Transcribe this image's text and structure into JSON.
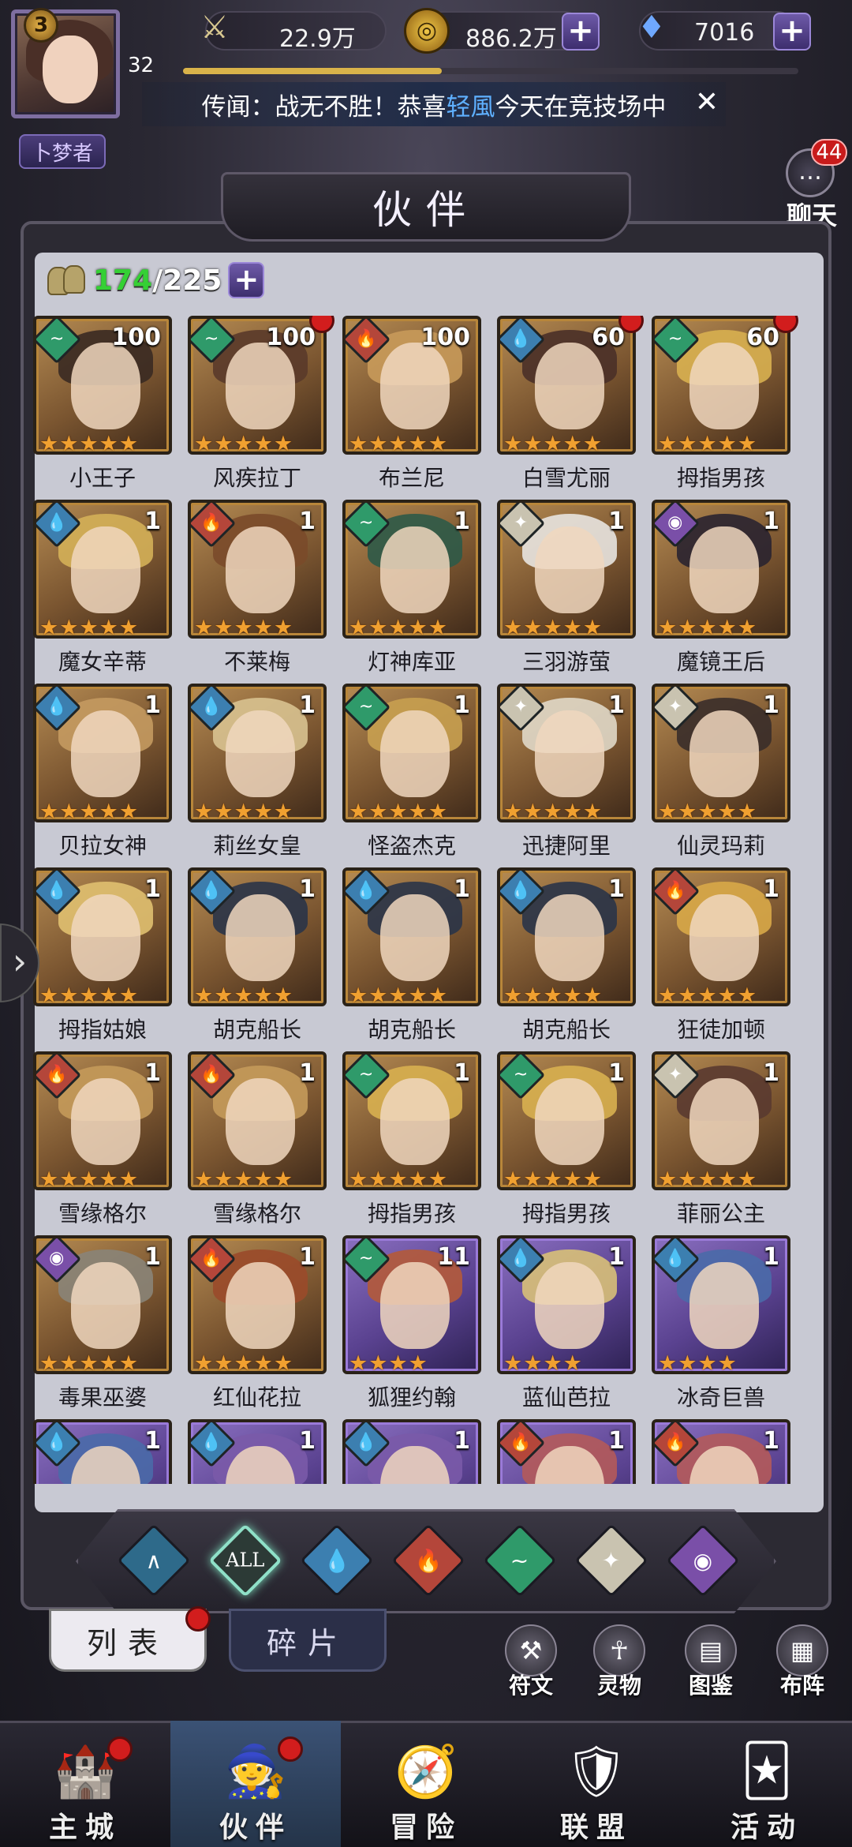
{
  "header": {
    "player_level": "3",
    "player_sub_level": "32",
    "player_title": "卜梦者",
    "power": "22.9万",
    "gold": "886.2万",
    "gems": "7016",
    "xp_progress": 0.42,
    "rumor_prefix": "传闻：战无不胜！恭喜",
    "rumor_name": "轻風",
    "rumor_suffix": "今天在竞技场中",
    "chat_label": "聊天",
    "chat_unread": "44"
  },
  "title": "伙伴",
  "roster": {
    "current": "174",
    "max": "/225"
  },
  "colors": {
    "water": "#3c7fb0",
    "wind": "#2f9a6a",
    "fire": "#b4463a",
    "light": "#c9c3b0",
    "dark": "#7a4fa8"
  },
  "heroes": [
    {
      "name": "小王子",
      "level": "100",
      "element": "wind",
      "frame": "gold",
      "stars": 5,
      "red": false,
      "hair": "#3a2a22"
    },
    {
      "name": "风疾拉丁",
      "level": "100",
      "element": "wind",
      "frame": "gold",
      "stars": 5,
      "red": true,
      "hair": "#5a3a2a"
    },
    {
      "name": "布兰尼",
      "level": "100",
      "element": "fire",
      "frame": "gold",
      "stars": 5,
      "red": false,
      "hair": "#c89a5a"
    },
    {
      "name": "白雪尤丽",
      "level": "60",
      "element": "water",
      "frame": "gold",
      "stars": 5,
      "red": true,
      "hair": "#4a3028"
    },
    {
      "name": "拇指男孩",
      "level": "60",
      "element": "wind",
      "frame": "gold",
      "stars": 5,
      "red": true,
      "hair": "#d8b050"
    },
    {
      "name": "魔女辛蒂",
      "level": "1",
      "element": "water",
      "frame": "gold",
      "stars": 5,
      "red": false,
      "hair": "#d4b058"
    },
    {
      "name": "不莱梅",
      "level": "1",
      "element": "fire",
      "frame": "gold",
      "stars": 5,
      "red": false,
      "hair": "#7a4a2a"
    },
    {
      "name": "灯神库亚",
      "level": "1",
      "element": "wind",
      "frame": "gold",
      "stars": 5,
      "red": false,
      "hair": "#2e5a48"
    },
    {
      "name": "三羽游萤",
      "level": "1",
      "element": "light",
      "frame": "gold",
      "stars": 5,
      "red": false,
      "hair": "#e8e4e0"
    },
    {
      "name": "魔镜王后",
      "level": "1",
      "element": "dark",
      "frame": "gold",
      "stars": 5,
      "red": false,
      "hair": "#2a2430"
    },
    {
      "name": "贝拉女神",
      "level": "1",
      "element": "water",
      "frame": "gold",
      "stars": 5,
      "red": false,
      "hair": "#c49a60"
    },
    {
      "name": "莉丝女皇",
      "level": "1",
      "element": "water",
      "frame": "gold",
      "stars": 5,
      "red": false,
      "hair": "#d8c290"
    },
    {
      "name": "怪盗杰克",
      "level": "1",
      "element": "wind",
      "frame": "gold",
      "stars": 5,
      "red": false,
      "hair": "#c8a050"
    },
    {
      "name": "迅捷阿里",
      "level": "1",
      "element": "light",
      "frame": "gold",
      "stars": 5,
      "red": false,
      "hair": "#e0d8c8"
    },
    {
      "name": "仙灵玛莉",
      "level": "1",
      "element": "light",
      "frame": "gold",
      "stars": 5,
      "red": false,
      "hair": "#3a2e2a"
    },
    {
      "name": "拇指姑娘",
      "level": "1",
      "element": "water",
      "frame": "gold",
      "stars": 5,
      "red": false,
      "hair": "#e0c070"
    },
    {
      "name": "胡克船长",
      "level": "1",
      "element": "water",
      "frame": "gold",
      "stars": 5,
      "red": false,
      "hair": "#2a3448"
    },
    {
      "name": "胡克船长",
      "level": "1",
      "element": "water",
      "frame": "gold",
      "stars": 5,
      "red": false,
      "hair": "#2a3448"
    },
    {
      "name": "胡克船长",
      "level": "1",
      "element": "water",
      "frame": "gold",
      "stars": 5,
      "red": false,
      "hair": "#2a3448"
    },
    {
      "name": "狂徒加顿",
      "level": "1",
      "element": "fire",
      "frame": "gold",
      "stars": 5,
      "red": false,
      "hair": "#d8a848"
    },
    {
      "name": "雪缘格尔",
      "level": "1",
      "element": "fire",
      "frame": "gold",
      "stars": 5,
      "red": false,
      "hair": "#c49a5a"
    },
    {
      "name": "雪缘格尔",
      "level": "1",
      "element": "fire",
      "frame": "gold",
      "stars": 5,
      "red": false,
      "hair": "#c49a5a"
    },
    {
      "name": "拇指男孩",
      "level": "1",
      "element": "wind",
      "frame": "gold",
      "stars": 5,
      "red": false,
      "hair": "#d8b050"
    },
    {
      "name": "拇指男孩",
      "level": "1",
      "element": "wind",
      "frame": "gold",
      "stars": 5,
      "red": false,
      "hair": "#d8b050"
    },
    {
      "name": "菲丽公主",
      "level": "1",
      "element": "light",
      "frame": "gold",
      "stars": 5,
      "red": false,
      "hair": "#5a3a30"
    },
    {
      "name": "毒果巫婆",
      "level": "1",
      "element": "dark",
      "frame": "gold",
      "stars": 5,
      "red": false,
      "hair": "#8a8478"
    },
    {
      "name": "红仙花拉",
      "level": "1",
      "element": "fire",
      "frame": "gold",
      "stars": 5,
      "red": false,
      "hair": "#9a4a2a"
    },
    {
      "name": "狐狸约翰",
      "level": "11",
      "element": "wind",
      "frame": "purple",
      "stars": 4,
      "red": false,
      "hair": "#b45a3a"
    },
    {
      "name": "蓝仙芭拉",
      "level": "1",
      "element": "water",
      "frame": "purple",
      "stars": 4,
      "red": false,
      "hair": "#d8c078"
    },
    {
      "name": "冰奇巨兽",
      "level": "1",
      "element": "water",
      "frame": "purple",
      "stars": 4,
      "red": false,
      "hair": "#4a6aa8"
    },
    {
      "name": "",
      "level": "1",
      "element": "water",
      "frame": "purple",
      "stars": 0,
      "red": false,
      "hair": "#4a6aa8"
    },
    {
      "name": "",
      "level": "1",
      "element": "water",
      "frame": "purple",
      "stars": 0,
      "red": false,
      "hair": "#7a5aa8"
    },
    {
      "name": "",
      "level": "1",
      "element": "water",
      "frame": "purple",
      "stars": 0,
      "red": false,
      "hair": "#7a5aa8"
    },
    {
      "name": "",
      "level": "1",
      "element": "fire",
      "frame": "purple",
      "stars": 0,
      "red": false,
      "hair": "#b45a5a"
    },
    {
      "name": "",
      "level": "1",
      "element": "fire",
      "frame": "purple",
      "stars": 0,
      "red": false,
      "hair": "#b45a5a"
    }
  ],
  "filters": [
    {
      "id": "water-alt",
      "label": "∧",
      "color": "#2e6a8a"
    },
    {
      "id": "all",
      "label": "ALL",
      "color": "#2c3a36",
      "active": true
    },
    {
      "id": "water",
      "label": "💧",
      "color": "#3c7fb0"
    },
    {
      "id": "fire",
      "label": "🔥",
      "color": "#b4463a"
    },
    {
      "id": "wind",
      "label": "~",
      "color": "#2f9a6a"
    },
    {
      "id": "light",
      "label": "✦",
      "color": "#c9c3b0"
    },
    {
      "id": "dark",
      "label": "◉",
      "color": "#7a4fa8"
    }
  ],
  "subtabs": {
    "list": "列表",
    "fragments": "碎片"
  },
  "tools": [
    "符文",
    "灵物",
    "图鉴",
    "布阵"
  ],
  "nav": [
    {
      "label": "主城",
      "icon": "🏰",
      "red": true
    },
    {
      "label": "伙伴",
      "icon": "🧙",
      "red": true,
      "active": true
    },
    {
      "label": "冒险",
      "icon": "🧭",
      "red": false
    },
    {
      "label": "联盟",
      "icon": "🛡",
      "red": false
    },
    {
      "label": "活动",
      "icon": "🃏",
      "red": false
    }
  ]
}
